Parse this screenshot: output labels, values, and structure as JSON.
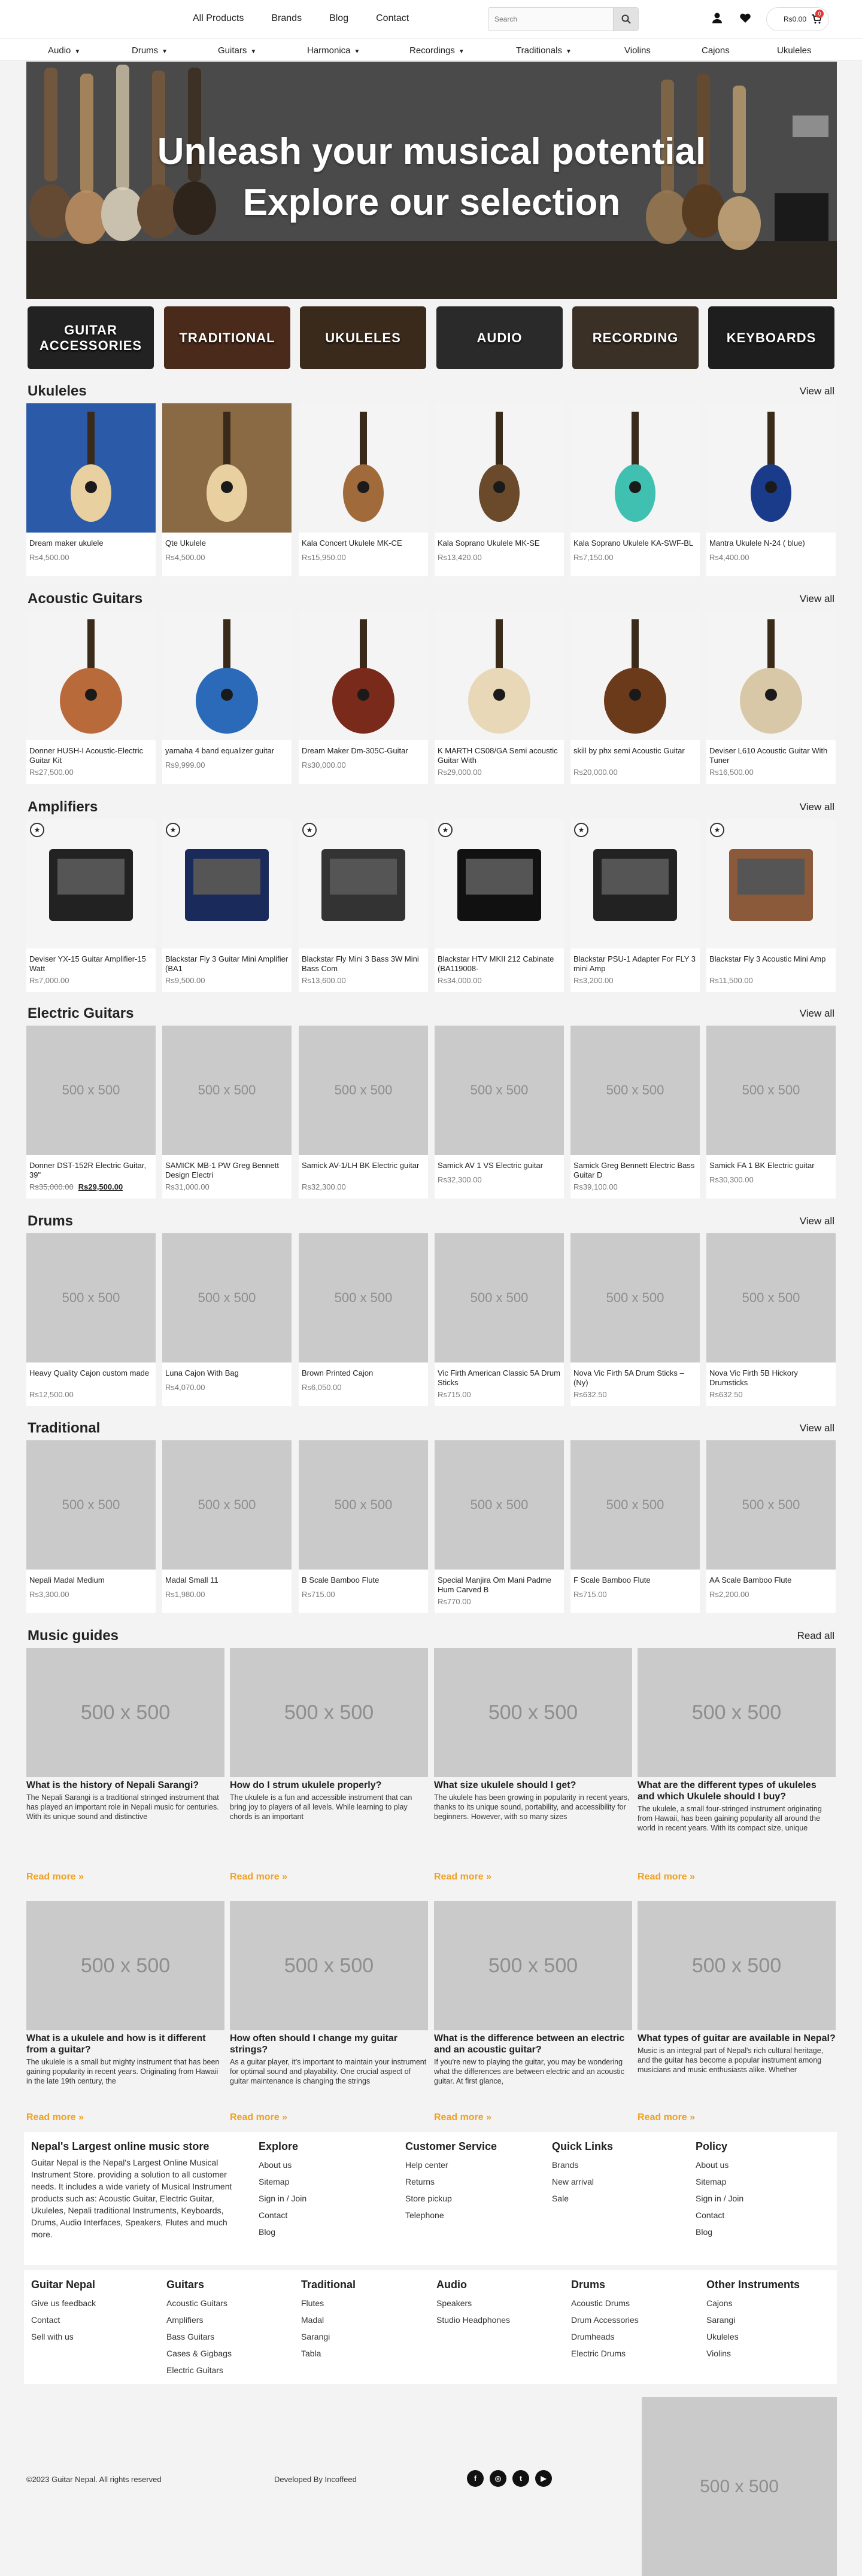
{
  "topnav": [
    "All Products",
    "Brands",
    "Blog",
    "Contact"
  ],
  "search": {
    "placeholder": "Search"
  },
  "cart": {
    "total": "Rs0.00",
    "count": "0"
  },
  "catnav": [
    {
      "label": "Audio",
      "chevron": true
    },
    {
      "label": "Drums",
      "chevron": true
    },
    {
      "label": "Guitars",
      "chevron": true
    },
    {
      "label": "Harmonica",
      "chevron": true
    },
    {
      "label": "Recordings",
      "chevron": true
    },
    {
      "label": "Traditionals",
      "chevron": true
    },
    {
      "label": "Violins",
      "chevron": false
    },
    {
      "label": "Cajons",
      "chevron": false
    },
    {
      "label": "Ukuleles",
      "chevron": false
    }
  ],
  "hero": {
    "line1": "Unleash your musical potential",
    "line2": "Explore our selection"
  },
  "tiles": [
    "GUITAR ACCESSORIES",
    "TRADITIONAL",
    "UKULELES",
    "AUDIO",
    "RECORDING",
    "KEYBOARDS"
  ],
  "view_all": "View all",
  "placeholder_label": "500 x 500",
  "sections": [
    {
      "title": "Ukuleles",
      "products": [
        {
          "name": "Dream maker ukulele",
          "price": "Rs4,500.00"
        },
        {
          "name": "Qte Ukulele",
          "price": "Rs4,500.00"
        },
        {
          "name": "Kala Concert Ukulele MK-CE",
          "price": "Rs15,950.00"
        },
        {
          "name": "Kala Soprano Ukulele MK-SE",
          "price": "Rs13,420.00"
        },
        {
          "name": "Kala Soprano Ukulele KA-SWF-BL",
          "price": "Rs7,150.00"
        },
        {
          "name": "Mantra Ukulele N-24 ( blue)",
          "price": "Rs4,400.00"
        }
      ]
    },
    {
      "title": "Acoustic Guitars",
      "products": [
        {
          "name": "Donner HUSH-I Acoustic-Electric Guitar Kit",
          "price": "Rs27,500.00"
        },
        {
          "name": "yamaha 4 band equalizer guitar",
          "price": "Rs9,999.00"
        },
        {
          "name": "Dream Maker Dm-305C-Guitar",
          "price": "Rs30,000.00"
        },
        {
          "name": "K MARTH CS08/GA Semi acoustic Guitar With",
          "price": "Rs29,000.00"
        },
        {
          "name": "skill by phx semi Acoustic Guitar",
          "price": "Rs20,000.00"
        },
        {
          "name": "Deviser L610 Acoustic Guitar With Tuner",
          "price": "Rs16,500.00"
        }
      ]
    },
    {
      "title": "Amplifiers",
      "products": [
        {
          "name": "Deviser YX-15 Guitar Amplifier-15 Watt",
          "price": "Rs7,000.00"
        },
        {
          "name": "Blackstar Fly 3 Guitar Mini Amplifier (BA1",
          "price": "Rs9,500.00"
        },
        {
          "name": "Blackstar Fly Mini 3 Bass 3W Mini Bass Com",
          "price": "Rs13,600.00"
        },
        {
          "name": "Blackstar HTV MKII 212 Cabinate (BA119008-",
          "price": "Rs34,000.00"
        },
        {
          "name": "Blackstar PSU-1 Adapter For FLY 3 mini Amp",
          "price": "Rs3,200.00"
        },
        {
          "name": "Blackstar Fly 3 Acoustic Mini Amp",
          "price": "Rs11,500.00"
        }
      ]
    },
    {
      "title": "Electric Guitars",
      "products": [
        {
          "name": "Donner DST-152R Electric Guitar, 39\"",
          "price": "Rs35,000.00",
          "sale": "Rs29,500.00"
        },
        {
          "name": "SAMICK MB-1 PW Greg Bennett Design Electri",
          "price": "Rs31,000.00"
        },
        {
          "name": "Samick AV-1/LH BK Electric guitar",
          "price": "Rs32,300.00"
        },
        {
          "name": "Samick AV 1 VS Electric guitar",
          "price": "Rs32,300.00"
        },
        {
          "name": "Samick Greg Bennett Electric Bass Guitar D",
          "price": "Rs39,100.00"
        },
        {
          "name": "Samick FA 1 BK Electric guitar",
          "price": "Rs30,300.00"
        }
      ]
    },
    {
      "title": "Drums",
      "products": [
        {
          "name": "Heavy Quality Cajon custom made",
          "price": "Rs12,500.00"
        },
        {
          "name": "Luna Cajon With Bag",
          "price": "Rs4,070.00"
        },
        {
          "name": "Brown Printed Cajon",
          "price": "Rs6,050.00"
        },
        {
          "name": "Vic Firth American Classic 5A Drum Sticks",
          "price": "Rs715.00"
        },
        {
          "name": "Nova Vic Firth 5A Drum Sticks – (Ny)",
          "price": "Rs632.50"
        },
        {
          "name": "Nova Vic Firth 5B Hickory Drumsticks",
          "price": "Rs632.50"
        }
      ]
    },
    {
      "title": "Traditional",
      "products": [
        {
          "name": "Nepali Madal Medium",
          "price": "Rs3,300.00"
        },
        {
          "name": "Madal Small 11",
          "price": "Rs1,980.00"
        },
        {
          "name": "B Scale Bamboo Flute",
          "price": "Rs715.00"
        },
        {
          "name": "Special Manjira Om Mani Padme Hum Carved B",
          "price": "Rs770.00"
        },
        {
          "name": "F Scale Bamboo Flute",
          "price": "Rs715.00"
        },
        {
          "name": "AA Scale Bamboo Flute",
          "price": "Rs2,200.00"
        }
      ]
    }
  ],
  "guides": {
    "title": "Music guides",
    "read_all": "Read all",
    "read_more": "Read more »",
    "items": [
      {
        "title": "What is the history of Nepali Sarangi?",
        "text": "The Nepali Sarangi is a traditional stringed instrument that has played an important role in Nepali music for centuries. With its unique sound and distinctive"
      },
      {
        "title": "How do I strum ukulele properly?",
        "text": "The ukulele is a fun and accessible instrument that can bring joy to players of all levels. While learning to play chords is an important"
      },
      {
        "title": "What size ukulele should I get?",
        "text": "The ukulele has been growing in popularity in recent years, thanks to its unique sound, portability, and accessibility for beginners. However, with so many sizes"
      },
      {
        "title": "What are the different types of ukuleles and which Ukulele should I buy?",
        "text": "The ukulele, a small four-stringed instrument originating from Hawaii, has been gaining popularity all around the world in recent years. With its compact size, unique"
      },
      {
        "title": "What is a ukulele and how is it different from a guitar?",
        "text": "The ukulele is a small but mighty instrument that has been gaining popularity in recent years. Originating from Hawaii in the late 19th century, the"
      },
      {
        "title": "How often should I change my guitar strings?",
        "text": "As a guitar player, it's important to maintain your instrument for optimal sound and playability. One crucial aspect of guitar maintenance is changing the strings"
      },
      {
        "title": "What is the difference between an electric and an acoustic guitar?",
        "text": "If you're new to playing the guitar, you may be wondering what the differences are between electric and an acoustic guitar. At first glance,"
      },
      {
        "title": "What types of guitar are available in Nepal?",
        "text": "Music is an integral part of Nepal's rich cultural heritage, and the guitar has become a popular instrument among musicians and music enthusiasts alike. Whether"
      }
    ]
  },
  "footer": {
    "about_title": "Nepal's Largest online music store",
    "about_text": "Guitar Nepal is the Nepal's Largest Online Musical Instrument Store. providing a solution to all customer needs. It includes a wide variety of Musical Instrument products such as: Acoustic Guitar, Electric Guitar, Ukuleles, Nepali traditional Instruments, Keyboards, Drums, Audio Interfaces, Speakers, Flutes and much more.",
    "cols1": [
      {
        "title": "Explore",
        "links": [
          "About us",
          "Sitemap",
          "Sign in / Join",
          "Contact",
          "Blog"
        ]
      },
      {
        "title": "Customer Service",
        "links": [
          "Help center",
          "Returns",
          "Store pickup",
          "Telephone"
        ]
      },
      {
        "title": "Quick Links",
        "links": [
          "Brands",
          "New arrival",
          "Sale"
        ]
      },
      {
        "title": "Policy",
        "links": [
          "About us",
          "Sitemap",
          "Sign in / Join",
          "Contact",
          "Blog"
        ]
      }
    ],
    "cols2": [
      {
        "title": "Guitar Nepal",
        "links": [
          "Give us feedback",
          "Contact",
          "Sell with us"
        ]
      },
      {
        "title": "Guitars",
        "links": [
          "Acoustic Guitars",
          "Amplifiers",
          "Bass Guitars",
          "Cases & Gigbags",
          "Electric Guitars"
        ]
      },
      {
        "title": "Traditional",
        "links": [
          "Flutes",
          "Madal",
          "Sarangi",
          "Tabla"
        ]
      },
      {
        "title": "Audio",
        "links": [
          "Speakers",
          "Studio Headphones"
        ]
      },
      {
        "title": "Drums",
        "links": [
          "Acoustic Drums",
          "Drum Accessories",
          "Drumheads",
          "Electric Drums"
        ]
      },
      {
        "title": "Other Instruments",
        "links": [
          "Cajons",
          "Sarangi",
          "Ukuleles",
          "Violins"
        ]
      }
    ],
    "copyright": "©2023 Guitar Nepal. All rights reserved",
    "developed": "Developed By Incoffeed",
    "social": [
      "facebook-icon",
      "instagram-icon",
      "twitter-icon",
      "youtube-icon"
    ]
  }
}
